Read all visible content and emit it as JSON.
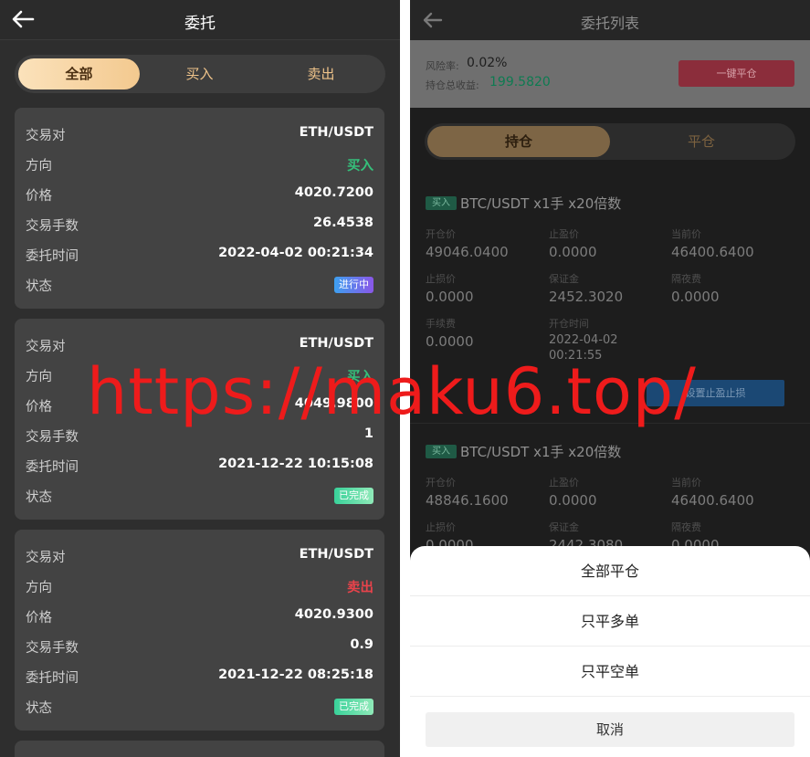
{
  "left": {
    "header": {
      "title": "委托"
    },
    "tabs": [
      "全部",
      "买入",
      "卖出"
    ],
    "labels": {
      "pair": "交易对",
      "direction": "方向",
      "price": "价格",
      "volume": "交易手数",
      "time": "委托时间",
      "status": "状态"
    },
    "orders": [
      {
        "pair": "ETH/USDT",
        "direction": "买入",
        "price": "4020.7200",
        "volume": "26.4538",
        "time": "2022-04-02 00:21:34",
        "status": "进行中"
      },
      {
        "pair": "ETH/USDT",
        "direction": "买入",
        "price": "4049.9800",
        "volume": "1",
        "time": "2021-12-22 10:15:08",
        "status": "已完成"
      },
      {
        "pair": "ETH/USDT",
        "direction": "卖出",
        "price": "4020.9300",
        "volume": "0.9",
        "time": "2021-12-22 08:25:18",
        "status": "已完成"
      }
    ]
  },
  "right": {
    "header": {
      "title": "委托列表"
    },
    "risk": {
      "label": "风险率:",
      "value": "0.02%",
      "profit_label": "持仓总收益:",
      "profit_value": "199.5820",
      "close_all_button": "一键平仓"
    },
    "tabs": [
      "持仓",
      "平仓"
    ],
    "field_labels": {
      "open_price": "开仓价",
      "take_profit": "止盈价",
      "current_price": "当前价",
      "stop_loss": "止损价",
      "margin": "保证金",
      "overnight_fee": "隔夜费",
      "fee": "手续费",
      "open_time": "开仓时间"
    },
    "positions": [
      {
        "tag": "买入",
        "name": "BTC/USDT x1手 x20倍数",
        "open_price": "49046.0400",
        "take_profit": "0.0000",
        "current_price": "46400.6400",
        "stop_loss": "0.0000",
        "margin": "2452.3020",
        "overnight_fee": "0.0000",
        "fee": "0.0000",
        "open_time_date": "2022-04-02",
        "open_time_clock": "00:21:55",
        "button": "设置止盈止损"
      },
      {
        "tag": "买入",
        "name": "BTC/USDT x1手 x20倍数",
        "open_price": "48846.1600",
        "take_profit": "0.0000",
        "current_price": "46400.6400",
        "stop_loss": "0.0000",
        "margin": "2442.3080",
        "overnight_fee": "0.0000"
      }
    ],
    "sheet": {
      "options": [
        "全部平仓",
        "只平多单",
        "只平空单"
      ],
      "cancel": "取消"
    }
  },
  "watermark": "https://maku6.top/",
  "colors": {
    "buy": "#35c07b",
    "sell": "#e8434b",
    "accent_gold": "#f3c98f",
    "watermark": "#ee1b1b"
  }
}
